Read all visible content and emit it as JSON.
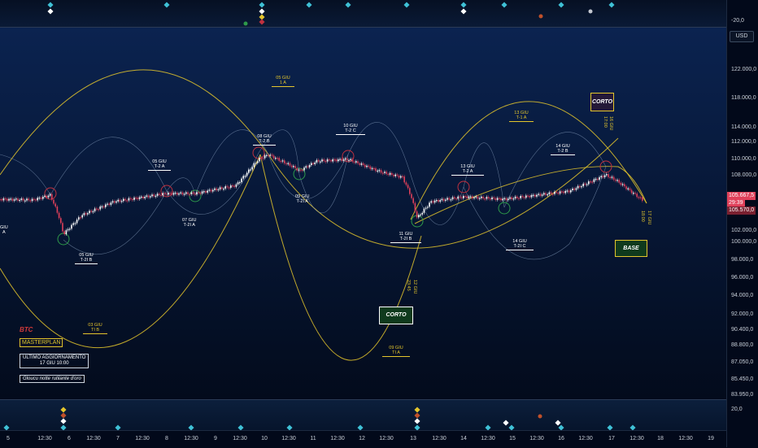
{
  "price_axis": {
    "currency": "USD",
    "top_value": "-20,0",
    "bottom_value": "20,0",
    "labels": [
      "122.000,0",
      "118.000,0",
      "114.000,0",
      "112.000,0",
      "110.000,0",
      "108.000,0",
      "106.000,0",
      "104.000,0",
      "102.000,0",
      "100.000,0",
      "98.000,0",
      "96.000,0",
      "94.000,0",
      "92.000,0",
      "90.400,0",
      "88.800,0",
      "87.050,0",
      "85.450,0",
      "83.950,0"
    ],
    "last_price": "105.667,5",
    "countdown": "29:39",
    "low_price": "105.570,0"
  },
  "time_axis": {
    "labels": [
      "5",
      "12:30",
      "6",
      "12:30",
      "7",
      "12:30",
      "8",
      "12:30",
      "9",
      "12:30",
      "10",
      "12:30",
      "11",
      "12:30",
      "12",
      "12:30",
      "13",
      "12:30",
      "14",
      "12:30",
      "15",
      "12:30",
      "16",
      "12:30",
      "17",
      "12:30",
      "18",
      "12:30",
      "19"
    ]
  },
  "annotations": [
    {
      "date": "05 GIU",
      "code": "1 A",
      "style": "gold"
    },
    {
      "date": "05 GIU",
      "code": "T-2 A",
      "style": "white"
    },
    {
      "date": "08 GIU",
      "code": "T-2 B",
      "style": "white"
    },
    {
      "date": "10 GIU",
      "code": "T-2 C",
      "style": "white"
    },
    {
      "date": "13 GIU",
      "code": "T-1 A",
      "style": "gold"
    },
    {
      "date": "13 GIU",
      "code": "T-2 A",
      "style": "white"
    },
    {
      "date": "14 GIU",
      "code": "T-2 B",
      "style": "white"
    },
    {
      "date": "07 GIU",
      "code": "T-2I A",
      "style": "white"
    },
    {
      "date": "09 GIU",
      "code": "T-2I A",
      "style": "white"
    },
    {
      "date": "05 GIU",
      "code": "T-2I B",
      "style": "white"
    },
    {
      "date": "11 GIU",
      "code": "T-2I B",
      "style": "white"
    },
    {
      "date": "14 GIU",
      "code": "T-2I C",
      "style": "white"
    },
    {
      "date": "03 GIU",
      "code": "TI B",
      "style": "gold"
    },
    {
      "date": "09 GIU",
      "code": "TI A",
      "style": "gold"
    },
    {
      "date": "GIU",
      "code": "A",
      "style": "white"
    }
  ],
  "signals": {
    "corto_top": "CORTO",
    "corto_bottom": "CORTO",
    "base": "BASE",
    "vert_top_1": "16 GIU",
    "vert_top_2": "17:00",
    "vert_right_1": "17 GIU",
    "vert_right_2": "18:00",
    "vert_mid_1": "12 GIU",
    "vert_mid_2": "23:45"
  },
  "info": {
    "ticker": "BTC",
    "brand": "MASTERPLAN",
    "update_title": "ULTIMO AGGIORNAMENTO",
    "update_time": "17 GIU 10:00",
    "tagline": "Gloucu notte rutilante d'oro"
  },
  "colors": {
    "gold": "#e4c52c",
    "up": "#ffffff",
    "down": "#e0405a",
    "cycle_line": "#8fa6c4",
    "green_circle": "#2e9a4a",
    "red_circle": "#c0313f"
  }
}
